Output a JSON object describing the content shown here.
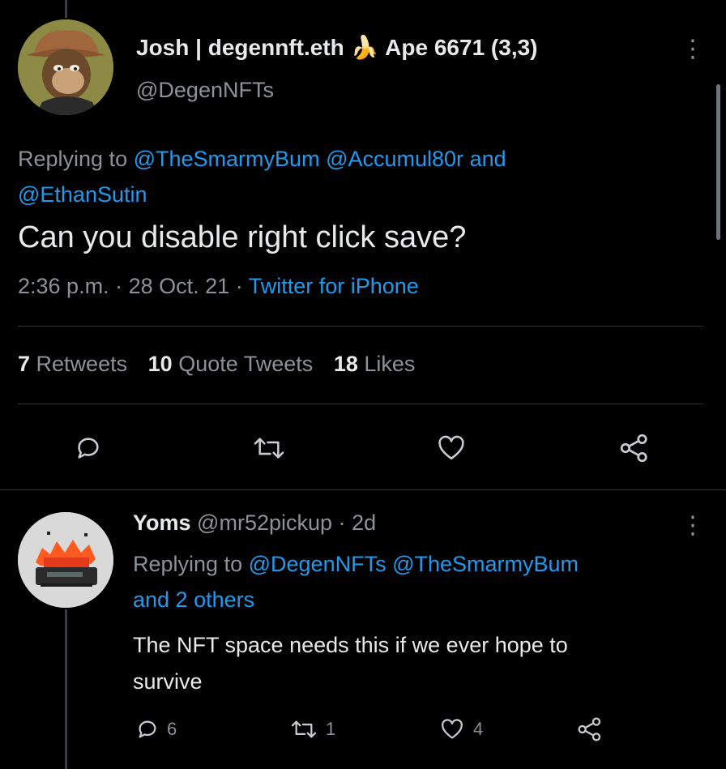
{
  "main_tweet": {
    "display_name": "Josh | degennft.eth",
    "name_suffix": "Ape 6671 (3,3)",
    "emoji": "🍌",
    "handle": "@DegenNFTs",
    "replying_prefix": "Replying to",
    "reply_to_1": "@TheSmarmyBum",
    "reply_to_2": "@Accumul80r",
    "reply_and": "and",
    "reply_to_3": "@EthanSutin",
    "text": "Can you disable right click save?",
    "time": "2:36 p.m.",
    "sep": "·",
    "date": "28 Oct. 21",
    "source": "Twitter for iPhone",
    "retweets_count": "7",
    "retweets_label": "Retweets",
    "quotes_count": "10",
    "quotes_label": "Quote Tweets",
    "likes_count": "18",
    "likes_label": "Likes"
  },
  "reply": {
    "display_name": "Yoms",
    "handle": "@mr52pickup",
    "sep": "·",
    "age": "2d",
    "replying_prefix": "Replying to",
    "reply_to_1": "@DegenNFTs",
    "reply_to_2": "@TheSmarmyBum",
    "reply_others": "and 2 others",
    "text_line1": "The NFT space needs this if we ever hope to",
    "text_line2": "survive",
    "reply_count": "6",
    "retweet_count": "1",
    "like_count": "4"
  },
  "more_glyph": "⋮",
  "colors": {
    "background": "#000000",
    "link": "#1d9bf0",
    "muted": "#8b9298",
    "text": "#e7e9ea"
  }
}
